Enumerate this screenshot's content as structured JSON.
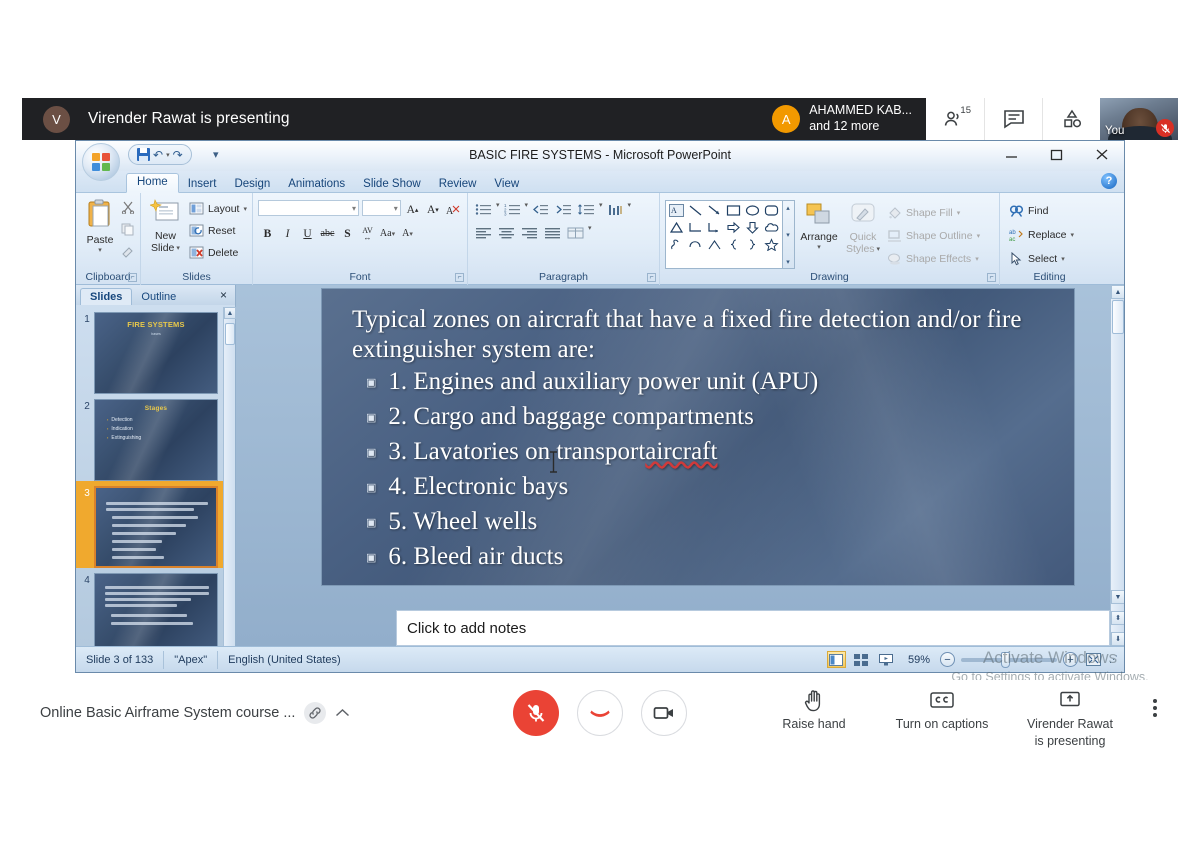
{
  "meet": {
    "top_bar": {
      "presenter_initial": "V",
      "presenting_text": "Virender Rawat is presenting",
      "speaker_chip": {
        "initial": "A",
        "name": "AHAMMED KAB...",
        "subtitle": "and 12 more"
      },
      "people_count": "15",
      "icons": {
        "people": "people-icon",
        "chat": "chat-icon",
        "activities": "activities-icon"
      },
      "self_view_label": "You"
    },
    "bottom_bar": {
      "meeting_name": "Online Basic Airframe System course ...",
      "link_icon": "link-icon",
      "chevron": "chevron-up-icon",
      "mic": {
        "label": "mic-off-icon",
        "state": "muted"
      },
      "end_call": {
        "label": "end-call-icon"
      },
      "camera": {
        "label": "camera-icon"
      },
      "raise_hand": {
        "label": "Raise hand",
        "icon": "hand-icon"
      },
      "captions": {
        "label": "Turn on captions",
        "icon": "closed-caption-icon"
      },
      "present": {
        "line1": "Virender Rawat",
        "line2": "is presenting",
        "icon": "present-screen-icon"
      },
      "more": "more-options-icon"
    }
  },
  "watermark": {
    "line1": "Activate Windows",
    "line2": "Go to Settings to activate Windows."
  },
  "powerpoint": {
    "title": "BASIC FIRE SYSTEMS - Microsoft PowerPoint",
    "window_buttons": {
      "minimize": "minimize-icon",
      "maximize": "maximize-icon",
      "close": "close-icon"
    },
    "quick_access": [
      "save-icon",
      "undo-icon",
      "redo-icon",
      "customize-qat-icon"
    ],
    "help_button": "?",
    "tabs": [
      {
        "label": "Home",
        "active": true
      },
      {
        "label": "Insert",
        "active": false
      },
      {
        "label": "Design",
        "active": false
      },
      {
        "label": "Animations",
        "active": false
      },
      {
        "label": "Slide Show",
        "active": false
      },
      {
        "label": "Review",
        "active": false
      },
      {
        "label": "View",
        "active": false
      }
    ],
    "ribbon_groups": [
      {
        "name": "Clipboard",
        "items": [
          "Paste",
          "Cut",
          "Copy",
          "Format Painter"
        ]
      },
      {
        "name": "Slides",
        "items": [
          "New Slide",
          "Layout",
          "Reset",
          "Delete"
        ]
      },
      {
        "name": "Font",
        "items": [
          "B",
          "I",
          "U",
          "abc",
          "S",
          "AV",
          "Aa",
          "A"
        ]
      },
      {
        "name": "Paragraph",
        "items": []
      },
      {
        "name": "Drawing",
        "items": [
          "Arrange",
          "Quick Styles",
          "Shape Fill",
          "Shape Outline",
          "Shape Effects"
        ]
      },
      {
        "name": "Editing",
        "items": [
          "Find",
          "Replace",
          "Select"
        ]
      }
    ],
    "clipboard": {
      "paste": "Paste"
    },
    "slides_group": {
      "new_slide_l1": "New",
      "new_slide_l2": "Slide",
      "layout": "Layout",
      "reset": "Reset",
      "delete": "Delete"
    },
    "drawing_group": {
      "arrange": "Arrange",
      "quick_l1": "Quick",
      "quick_l2": "Styles",
      "shape_fill": "Shape Fill",
      "shape_outline": "Shape Outline",
      "shape_effects": "Shape Effects"
    },
    "editing_group": {
      "find": "Find",
      "replace": "Replace",
      "select": "Select"
    },
    "slides_pane": {
      "tabs": [
        {
          "label": "Slides",
          "active": true
        },
        {
          "label": "Outline",
          "active": false
        }
      ],
      "close": "×",
      "thumbnails": [
        {
          "num": "1",
          "title": "FIRE SYSTEMS",
          "subtitle": "bases",
          "selected": false
        },
        {
          "num": "2",
          "title": "Stages",
          "bullets": [
            "Detection",
            "Indication",
            "Extinguishing"
          ],
          "selected": false
        },
        {
          "num": "3",
          "title": "",
          "selected": true
        },
        {
          "num": "4",
          "title": "",
          "selected": false
        }
      ]
    },
    "slide": {
      "lead": "Typical zones on aircraft that have a fixed fire detection and/or fire extinguisher system are:",
      "bullets": [
        {
          "text": "1. Engines and auxiliary power unit (APU)",
          "misspelled": ""
        },
        {
          "text": "2. Cargo and baggage compartments",
          "misspelled": ""
        },
        {
          "text": "3. Lavatories on transport ",
          "misspelled": "aircraft"
        },
        {
          "text": "4. Electronic bays",
          "misspelled": ""
        },
        {
          "text": "5. Wheel wells",
          "misspelled": ""
        },
        {
          "text": "6. Bleed air ducts",
          "misspelled": ""
        }
      ]
    },
    "notes_placeholder": "Click to add notes",
    "status_bar": {
      "slide_count": "Slide 3 of 133",
      "theme": "\"Apex\"",
      "language": "English (United States)",
      "zoom": "59%",
      "views": [
        "normal-view-icon",
        "slide-sorter-icon",
        "slideshow-icon"
      ],
      "zoom_out": "−",
      "zoom_in": "+",
      "fit_window": "fit-slide-icon"
    }
  }
}
